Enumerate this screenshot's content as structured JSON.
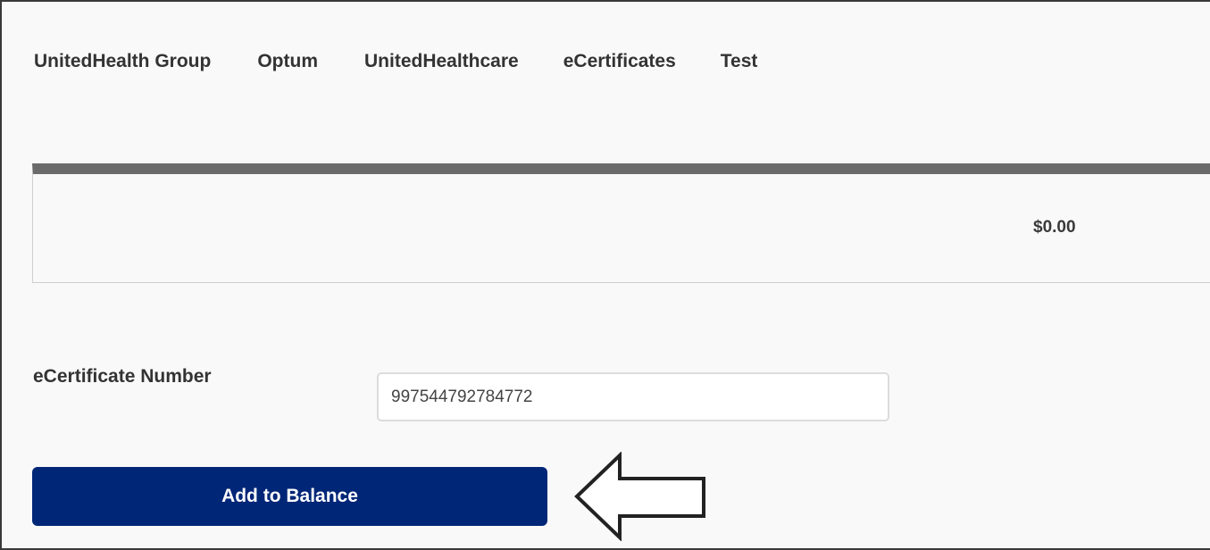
{
  "nav": {
    "items": [
      {
        "label": "UnitedHealth Group"
      },
      {
        "label": "Optum"
      },
      {
        "label": "UnitedHealthcare"
      },
      {
        "label": "eCertificates"
      },
      {
        "label": "Test"
      }
    ]
  },
  "balance": {
    "amount": "$0.00"
  },
  "form": {
    "ecertificate_label": "eCertificate Number",
    "ecertificate_value": "997544792784772",
    "submit_label": "Add to Balance"
  },
  "colors": {
    "primary_button": "#002677",
    "panel_header_bar": "#6b6b6b"
  },
  "icons": {
    "callout_arrow": "left-arrow-outline-icon"
  }
}
